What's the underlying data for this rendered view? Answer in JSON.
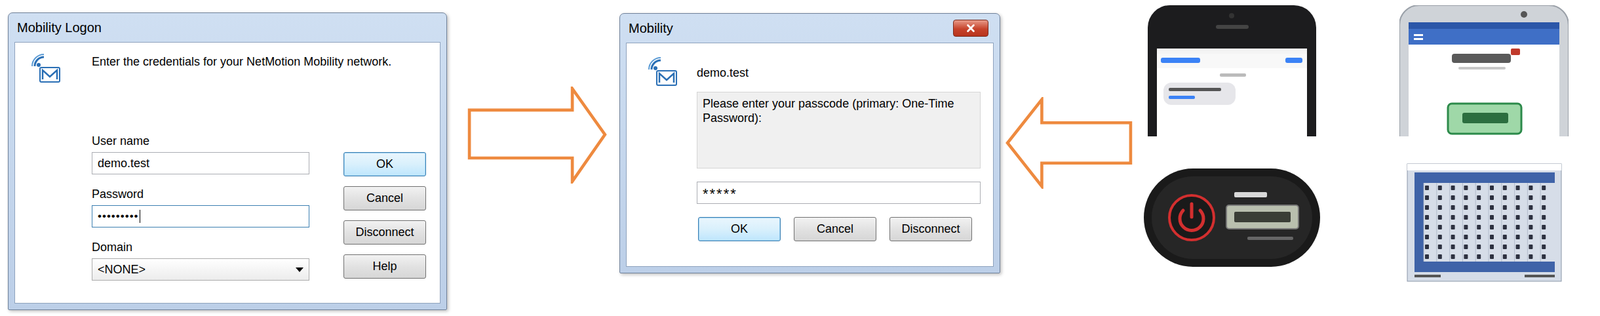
{
  "logon_dialog": {
    "title": "Mobility Logon",
    "prompt": "Enter the credentials for your NetMotion Mobility network.",
    "fields": [
      {
        "label": "User name",
        "value": "demo.test",
        "kind": "text",
        "focused": false
      },
      {
        "label": "Password",
        "value": "•••••••••",
        "kind": "password",
        "focused": true
      },
      {
        "label": "Domain",
        "value": "<NONE>",
        "kind": "select",
        "focused": false
      }
    ],
    "buttons": [
      {
        "label": "OK",
        "default": true
      },
      {
        "label": "Cancel",
        "default": false
      },
      {
        "label": "Disconnect",
        "default": false
      },
      {
        "label": "Help",
        "default": false
      }
    ]
  },
  "arrows": [
    {
      "kind": "right"
    },
    {
      "kind": "left"
    }
  ],
  "passcode_dialog": {
    "title": "Mobility",
    "user": "demo.test",
    "message": "Please enter your passcode (primary: One-Time Password):",
    "input": "*****",
    "buttons": [
      {
        "label": "OK",
        "default": true
      },
      {
        "label": "Cancel",
        "default": false
      },
      {
        "label": "Disconnect",
        "default": false
      }
    ]
  },
  "devices": [
    {
      "kind": "sms-phone"
    },
    {
      "kind": "app-phone"
    },
    {
      "kind": "token"
    },
    {
      "kind": "grid-card"
    }
  ]
}
